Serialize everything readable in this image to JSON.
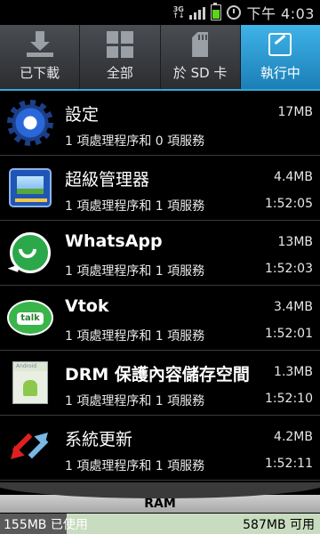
{
  "status_bar": {
    "network": "3G",
    "time": "下午 4:03"
  },
  "tabs": [
    {
      "label": "已下載",
      "icon": "download-icon",
      "active": false
    },
    {
      "label": "全部",
      "icon": "grid-icon",
      "active": false
    },
    {
      "label": "於 SD 卡",
      "icon": "sd-card-icon",
      "active": false
    },
    {
      "label": "執行中",
      "icon": "running-icon",
      "active": true
    }
  ],
  "apps": [
    {
      "name": "設定",
      "detail": "1 項處理程序和 0 項服務",
      "size": "17MB",
      "time": "",
      "icon": "settings-gear-icon"
    },
    {
      "name": "超級管理器",
      "detail": "1 項處理程序和 1 項服務",
      "size": "4.4MB",
      "time": "1:52:05",
      "icon": "task-manager-icon"
    },
    {
      "name": "WhatsApp",
      "detail": "1 項處理程序和 1 項服務",
      "size": "13MB",
      "time": "1:52:03",
      "icon": "whatsapp-icon"
    },
    {
      "name": "Vtok",
      "detail": "1 項處理程序和 1 項服務",
      "size": "3.4MB",
      "time": "1:52:01",
      "icon": "vtok-icon",
      "icon_text": "talk"
    },
    {
      "name": "DRM 保護內容儲存空間",
      "detail": "1 項處理程序和 1 項服務",
      "size": "1.3MB",
      "time": "1:52:10",
      "icon": "android-drm-icon",
      "icon_text": "Android"
    },
    {
      "name": "系統更新",
      "detail": "1 項處理程序和 1 項服務",
      "size": "4.2MB",
      "time": "1:52:11",
      "icon": "system-update-icon"
    }
  ],
  "ram": {
    "title": "RAM",
    "used": "155MB 已使用",
    "free": "587MB 可用",
    "used_fraction": 0.209
  },
  "colors": {
    "accent": "#2c9fd8",
    "ram_free": "#c8dcc0",
    "ram_used": "#5a5a5a"
  }
}
